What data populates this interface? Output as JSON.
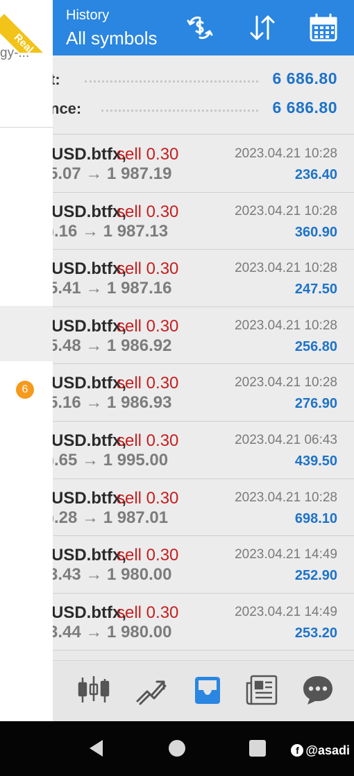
{
  "drawer": {
    "ribbon_label": "Real",
    "strategy_text": "gy-...",
    "badge_count": "6"
  },
  "header": {
    "title": "History",
    "subtitle": "All symbols",
    "icons": [
      "currency-exchange-icon",
      "sort-icon",
      "calendar-icon"
    ]
  },
  "summary": {
    "rows": [
      {
        "label": "t:",
        "value": "6 686.80"
      },
      {
        "label": "nce:",
        "value": "6 686.80"
      }
    ]
  },
  "trades": [
    {
      "symbol": "USD.btfx,",
      "side": "sell 0.30",
      "prices": "5.07 → 1 987.19",
      "time": "2023.04.21 10:28",
      "profit": "236.40"
    },
    {
      "symbol": "USD.btfx,",
      "side": "sell 0.30",
      "prices": ").16 → 1 987.13",
      "time": "2023.04.21 10:28",
      "profit": "360.90"
    },
    {
      "symbol": "USD.btfx,",
      "side": "sell 0.30",
      "prices": "5.41 → 1 987.16",
      "time": "2023.04.21 10:28",
      "profit": "247.50"
    },
    {
      "symbol": "USD.btfx,",
      "side": "sell 0.30",
      "prices": "5.48 → 1 986.92",
      "time": "2023.04.21 10:28",
      "profit": "256.80"
    },
    {
      "symbol": "USD.btfx,",
      "side": "sell 0.30",
      "prices": "5.16 → 1 986.93",
      "time": "2023.04.21 10:28",
      "profit": "276.90"
    },
    {
      "symbol": "USD.btfx,",
      "side": "sell 0.30",
      "prices": ").65 → 1 995.00",
      "time": "2023.04.21 06:43",
      "profit": "439.50"
    },
    {
      "symbol": "USD.btfx,",
      "side": "sell 0.30",
      "prices": ").28 → 1 987.01",
      "time": "2023.04.21 10:28",
      "profit": "698.10"
    },
    {
      "symbol": "USD.btfx,",
      "side": "sell 0.30",
      "prices": "3.43 → 1 980.00",
      "time": "2023.04.21 14:49",
      "profit": "252.90"
    },
    {
      "symbol": "USD.btfx,",
      "side": "sell 0.30",
      "prices": "3.44 → 1 980.00",
      "time": "2023.04.21 14:49",
      "profit": "253.20"
    }
  ],
  "bottom_nav": {
    "items": [
      "quotes-icon",
      "chart-icon",
      "history-inbox-icon",
      "news-icon",
      "chat-icon"
    ],
    "active": "history-inbox-icon"
  },
  "system_bar": {
    "watermark": "@asadi"
  },
  "colors": {
    "header_blue": "#2a86e0",
    "value_blue": "#1e73c8",
    "sell_red": "#c41f1f",
    "ribbon_yellow": "#f2c318",
    "badge_orange": "#f59a1d"
  }
}
